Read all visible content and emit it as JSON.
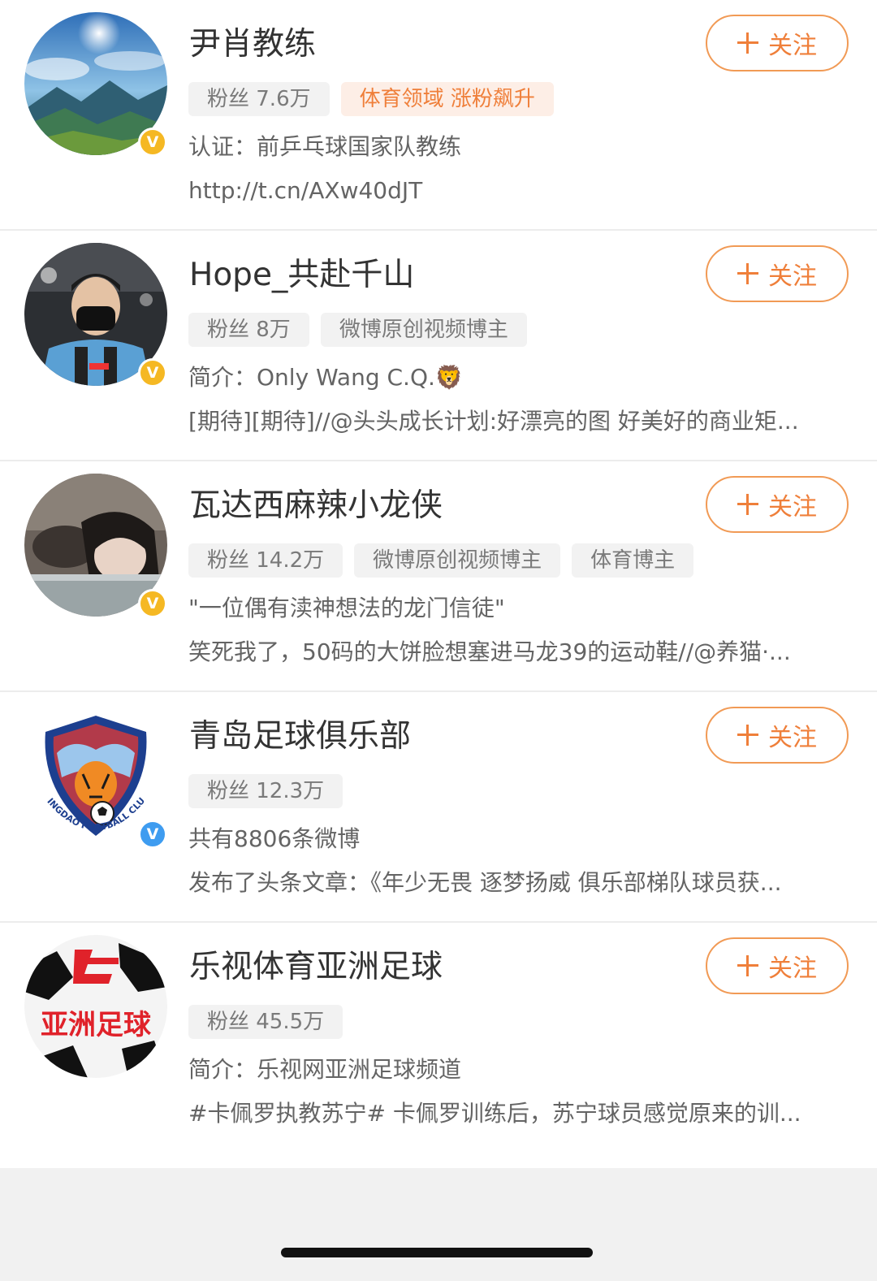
{
  "follow_label": "关注",
  "users": [
    {
      "name": "尹肖教练",
      "badge_color": "gold",
      "tags": [
        {
          "text": "粉丝 7.6万",
          "kind": "normal"
        },
        {
          "text": "体育领域 涨粉飙升",
          "kind": "hot"
        }
      ],
      "line1": "认证：前乒乓球国家队教练",
      "line2": "http://t.cn/AXw40dJT"
    },
    {
      "name": "Hope_共赴千山",
      "badge_color": "gold",
      "tags": [
        {
          "text": "粉丝 8万",
          "kind": "normal"
        },
        {
          "text": "微博原创视频博主",
          "kind": "normal"
        }
      ],
      "line1": "简介：Only Wang C.Q.🦁",
      "line2": "[期待][期待]//@头头成长计划:好漂亮的图 好美好的商业矩..."
    },
    {
      "name": "瓦达西麻辣小龙侠",
      "badge_color": "gold",
      "tags": [
        {
          "text": "粉丝 14.2万",
          "kind": "normal"
        },
        {
          "text": "微博原创视频博主",
          "kind": "normal"
        },
        {
          "text": "体育博主",
          "kind": "normal"
        }
      ],
      "line1": "\"一位偶有渎神想法的龙门信徒\"",
      "line2": "笑死我了，50码的大饼脸想塞进马龙39的运动鞋//@养猫·..."
    },
    {
      "name": "青岛足球俱乐部",
      "badge_color": "blue",
      "avatar_text": "QINGDAO FOOTBALL CLUB",
      "tags": [
        {
          "text": "粉丝 12.3万",
          "kind": "normal"
        }
      ],
      "line1": "共有8806条微博",
      "line2": "发布了头条文章：《年少无畏 逐梦扬威 俱乐部梯队球员获..."
    },
    {
      "name": "乐视体育亚洲足球",
      "badge_color": "none",
      "avatar_text": "亚洲足球",
      "tags": [
        {
          "text": "粉丝 45.5万",
          "kind": "normal"
        }
      ],
      "line1": "简介：乐视网亚洲足球频道",
      "line2": "#卡佩罗执教苏宁# 卡佩罗训练后，苏宁球员感觉原来的训..."
    }
  ]
}
